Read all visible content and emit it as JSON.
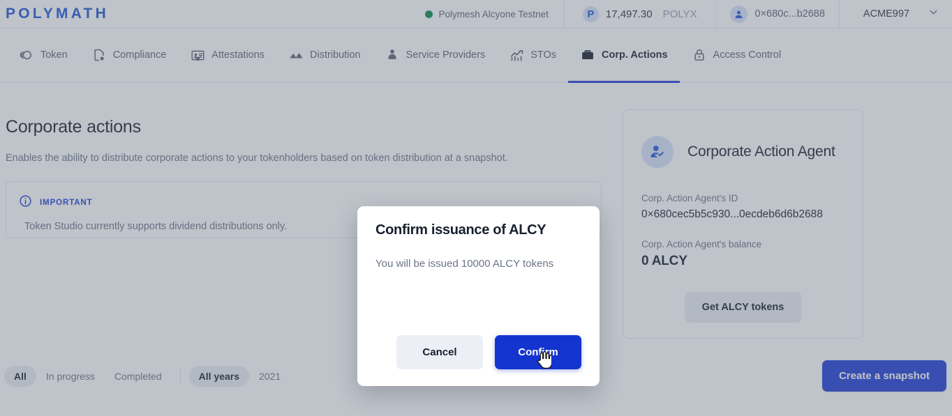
{
  "header": {
    "logo": "POLYMATH",
    "network": {
      "label": "Polymesh Alcyone Testnet",
      "status_color": "#0b8a4a"
    },
    "balance": {
      "badge": "P",
      "amount": "17,497.30",
      "unit": "POLYX"
    },
    "account": {
      "id": "0×680c...b2688"
    },
    "organization": {
      "name": "ACME997"
    }
  },
  "nav": {
    "items": [
      {
        "label": "Token",
        "icon": "token-icon",
        "active": false
      },
      {
        "label": "Compliance",
        "icon": "compliance-icon",
        "active": false
      },
      {
        "label": "Attestations",
        "icon": "attestations-icon",
        "active": false
      },
      {
        "label": "Distribution",
        "icon": "distribution-icon",
        "active": false
      },
      {
        "label": "Service Providers",
        "icon": "service-providers-icon",
        "active": false
      },
      {
        "label": "STOs",
        "icon": "stos-icon",
        "active": false
      },
      {
        "label": "Corp. Actions",
        "icon": "corp-actions-icon",
        "active": true
      },
      {
        "label": "Access Control",
        "icon": "access-control-icon",
        "active": false
      }
    ]
  },
  "main": {
    "title": "Corporate actions",
    "subtitle": "Enables the ability to distribute corporate actions to your tokenholders based on token distribution at a snapshot.",
    "notice": {
      "label": "IMPORTANT",
      "text": "Token Studio currently supports dividend distributions only.",
      "accent": "#1f3fd6"
    },
    "filters": {
      "status": [
        {
          "label": "All",
          "selected": true
        },
        {
          "label": "In progress",
          "selected": false
        },
        {
          "label": "Completed",
          "selected": false
        }
      ],
      "years": [
        {
          "label": "All years",
          "selected": true
        },
        {
          "label": "2021",
          "selected": false
        }
      ]
    },
    "create_snapshot_label": "Create a snapshot"
  },
  "agent_card": {
    "title": "Corporate Action Agent",
    "icon": "user-check-icon",
    "id_label": "Corp. Action Agent's ID",
    "id_value": "0×680cec5b5c930...0ecdeb6d6b2688",
    "balance_label": "Corp. Action Agent's balance",
    "balance_value": "0 ALCY",
    "get_tokens_label": "Get ALCY tokens"
  },
  "modal": {
    "title": "Confirm issuance of ALCY",
    "message": "You will be issued 10000 ALCY tokens",
    "cancel_label": "Cancel",
    "confirm_label": "Confirm",
    "confirm_color": "#1434cf"
  },
  "cursor": {
    "type": "pointer-hand-cursor"
  }
}
